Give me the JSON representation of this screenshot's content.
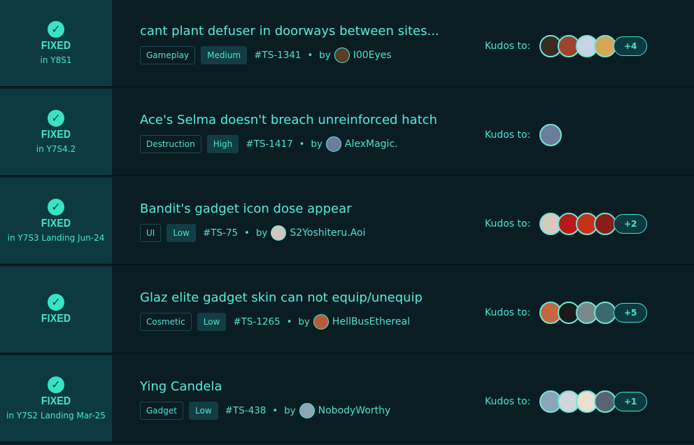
{
  "kudos_label": "Kudos to:",
  "rows": [
    {
      "status": "FIXED",
      "version": "in Y8S1",
      "title": "cant plant defuser in doorways between sites...",
      "category": "Gameplay",
      "priority": "Medium",
      "ticket": "#TS-1341",
      "by": "by",
      "author": "I00Eyes",
      "author_avatar_color": "#5a3d24",
      "kudos_avatar_colors": [
        "#3a2a22",
        "#a1422e",
        "#c7d4e8",
        "#d6a55a"
      ],
      "kudos_more": "+4"
    },
    {
      "status": "FIXED",
      "version": "in Y7S4.2",
      "title": "Ace's Selma doesn't breach unreinforced hatch",
      "category": "Destruction",
      "priority": "High",
      "ticket": "#TS-1417",
      "by": "by",
      "author": "AlexMagic.",
      "author_avatar_color": "#6b7d9a",
      "kudos_avatar_colors": [
        "#6b7d9a"
      ],
      "kudos_more": ""
    },
    {
      "status": "FIXED",
      "version": "in Y7S3 Landing Jun-24",
      "title": "Bandit's gadget icon dose appear",
      "category": "UI",
      "priority": "Low",
      "ticket": "#TS-75",
      "by": "by",
      "author": "S2Yoshiteru.Aoi",
      "author_avatar_color": "#cfc7c0",
      "kudos_avatar_colors": [
        "#d8c8c0",
        "#b71a1a",
        "#c4321c",
        "#8a1c1c"
      ],
      "kudos_more": "+2"
    },
    {
      "status": "FIXED",
      "version": "",
      "title": "Glaz elite gadget skin can not equip/unequip",
      "category": "Cosmetic",
      "priority": "Low",
      "ticket": "#TS-1265",
      "by": "by",
      "author": "HellBusEthereal",
      "author_avatar_color": "#b85a3a",
      "kudos_avatar_colors": [
        "#c4673e",
        "#1a1a1a",
        "#7a8a8a",
        "#3a6a70"
      ],
      "kudos_more": "+5"
    },
    {
      "status": "FIXED",
      "version": "in Y7S2 Landing Mar-25",
      "title": "Ying Candela",
      "category": "Gadget",
      "priority": "Low",
      "ticket": "#TS-438",
      "by": "by",
      "author": "NobodyWorthy",
      "author_avatar_color": "#8aa4b8",
      "kudos_avatar_colors": [
        "#8aa4b8",
        "#cfd6dc",
        "#e8e0d0",
        "#5a6470"
      ],
      "kudos_more": "+1"
    }
  ]
}
